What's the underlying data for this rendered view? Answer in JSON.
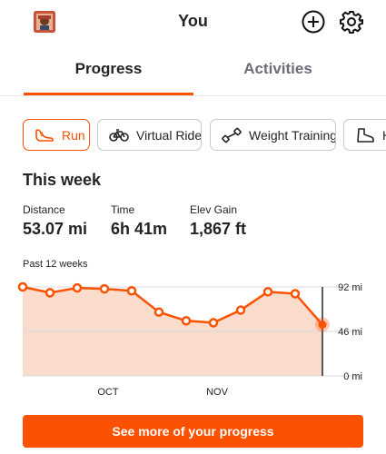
{
  "header": {
    "title": "You"
  },
  "tabs": [
    {
      "label": "Progress",
      "selected": true
    },
    {
      "label": "Activities",
      "selected": false
    }
  ],
  "sport_chips": [
    {
      "label": "Run",
      "icon": "run-shoe-icon",
      "selected": true
    },
    {
      "label": "Virtual Ride",
      "icon": "bike-icon",
      "selected": false
    },
    {
      "label": "Weight Training",
      "icon": "dumbbell-icon",
      "selected": false
    },
    {
      "label": "H",
      "icon": "hike-boot-icon",
      "selected": false
    }
  ],
  "this_week": {
    "title": "This week",
    "stats": [
      {
        "label": "Distance",
        "value": "53.07 mi"
      },
      {
        "label": "Time",
        "value": "6h 41m"
      },
      {
        "label": "Elev Gain",
        "value": "1,867 ft"
      }
    ]
  },
  "chart_label": "Past 12 weeks",
  "chart_data": {
    "type": "area",
    "title": "Past 12 weeks",
    "y_unit": "mi",
    "ylim": [
      0,
      92
    ],
    "y_ticks": [
      {
        "value": 92,
        "label": "92 mi"
      },
      {
        "value": 46,
        "label": "46 mi"
      },
      {
        "value": 0,
        "label": "0 mi"
      }
    ],
    "x_tick_labels": [
      {
        "index": 3,
        "label": "OCT"
      },
      {
        "index": 7,
        "label": "NOV"
      }
    ],
    "series": [
      {
        "values": [
          92,
          86,
          91,
          90,
          88,
          66,
          57,
          55,
          68,
          87,
          85,
          53
        ]
      }
    ],
    "highlight_index": 11,
    "grid": true
  },
  "cta": {
    "label": "See more of your progress"
  },
  "colors": {
    "accent": "#fc5200",
    "area_fill": "#f9d6c4",
    "text": "#242428",
    "muted": "#6d6d78"
  }
}
